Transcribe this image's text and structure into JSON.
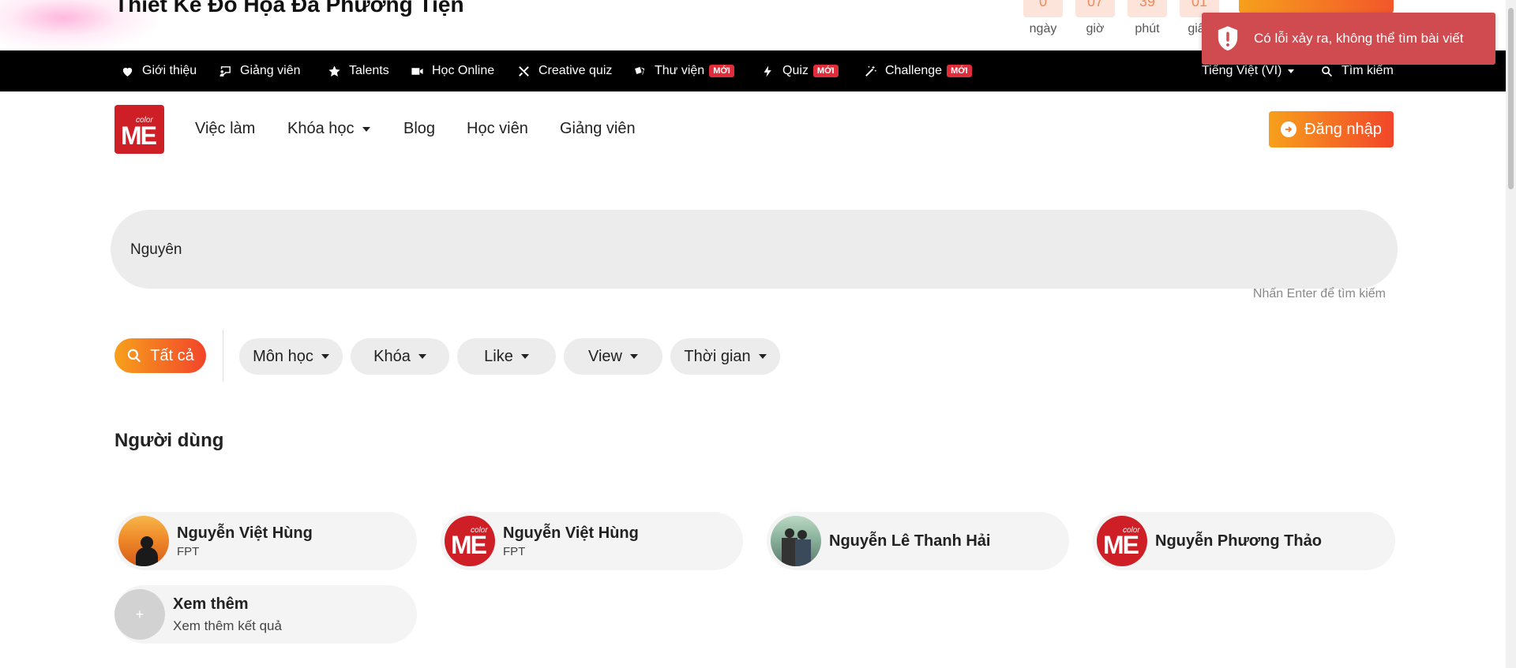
{
  "promo": {
    "title": "Thiết Kế Đồ Họa Đa Phương Tiện",
    "countdown": [
      {
        "value": "0",
        "label": "ngày"
      },
      {
        "value": "07",
        "label": "giờ"
      },
      {
        "value": "39",
        "label": "phút"
      },
      {
        "value": "01",
        "label": "giây"
      }
    ]
  },
  "toast": {
    "message": "Có lỗi xảy ra, không thể tìm bài viết",
    "color": "#cf4b4f"
  },
  "topnav": {
    "items": [
      {
        "label": "Giới thiệu",
        "icon": "heart-icon"
      },
      {
        "label": "Giảng viên",
        "icon": "teacher-icon"
      },
      {
        "label": "Talents",
        "icon": "star-icon"
      },
      {
        "label": "Học Online",
        "icon": "video-icon"
      },
      {
        "label": "Creative quiz",
        "icon": "tools-icon"
      },
      {
        "label": "Thư viện",
        "icon": "cards-icon",
        "badge": "MỚI"
      },
      {
        "label": "Quiz",
        "icon": "bolt-icon",
        "badge": "MỚI"
      },
      {
        "label": "Challenge",
        "icon": "magic-wand-icon",
        "badge": "MỚI"
      }
    ],
    "language": "Tiếng Việt (VI)",
    "search": "Tìm kiếm"
  },
  "header": {
    "logo_small": "color",
    "logo_big": "ME",
    "nav": [
      "Việc làm",
      "Khóa học",
      "Blog",
      "Học viên",
      "Giảng viên"
    ],
    "login": "Đăng nhập"
  },
  "search": {
    "value": "Nguyên",
    "hint": "Nhấn Enter để tìm kiếm"
  },
  "filters": {
    "all": "Tất cả",
    "pills": [
      "Môn học",
      "Khóa",
      "Like",
      "View",
      "Thời gian"
    ]
  },
  "users": {
    "title": "Người dùng",
    "items": [
      {
        "name": "Nguyễn Việt Hùng",
        "sub": "FPT",
        "avatar": "photo"
      },
      {
        "name": "Nguyễn Việt Hùng",
        "sub": "FPT",
        "avatar": "logo"
      },
      {
        "name": "Nguyễn Lê Thanh Hải",
        "sub": "",
        "avatar": "photo"
      },
      {
        "name": "Nguyễn Phương Thảo",
        "sub": "",
        "avatar": "logo"
      }
    ],
    "more": {
      "title": "Xem thêm",
      "sub": "Xem thêm kết quả",
      "icon": "+"
    }
  },
  "colors": {
    "brand_red": "#cf1f26",
    "gradient_start": "#f7a01c",
    "gradient_end": "#f2452a",
    "badge_red": "#e02d3c"
  }
}
